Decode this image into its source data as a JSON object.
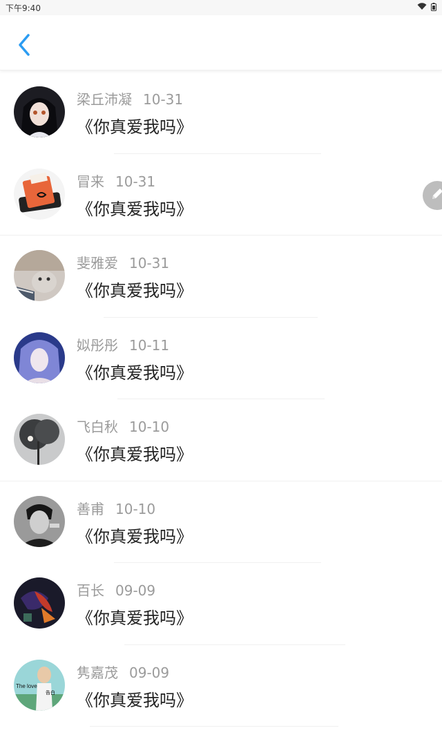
{
  "status_bar": {
    "time": "下午9:40",
    "icons": [
      "wifi-icon",
      "battery-icon"
    ]
  },
  "app_bar": {
    "back_icon": "chevron-left-icon",
    "accent": "#2b9cf2"
  },
  "fab": {
    "icon": "pencil-icon",
    "color": "#bdbdbd"
  },
  "items": [
    {
      "name": "梁丘沛凝",
      "date": "10-31",
      "message": "《你真爱我吗》"
    },
    {
      "name": "冒来",
      "date": "10-31",
      "message": "《你真爱我吗》"
    },
    {
      "name": "斐雅爱",
      "date": "10-31",
      "message": "《你真爱我吗》"
    },
    {
      "name": "姒彤彤",
      "date": "10-11",
      "message": "《你真爱我吗》"
    },
    {
      "name": "飞白秋",
      "date": "10-10",
      "message": "《你真爱我吗》"
    },
    {
      "name": "善甫",
      "date": "10-10",
      "message": "《你真爱我吗》"
    },
    {
      "name": "百长",
      "date": "09-09",
      "message": "《你真爱我吗》"
    },
    {
      "name": "隽嘉茂",
      "date": "09-09",
      "message": "《你真爱我吗》"
    }
  ],
  "avatar_art": {
    "text_line1": "The love",
    "text_line2": "告白"
  }
}
